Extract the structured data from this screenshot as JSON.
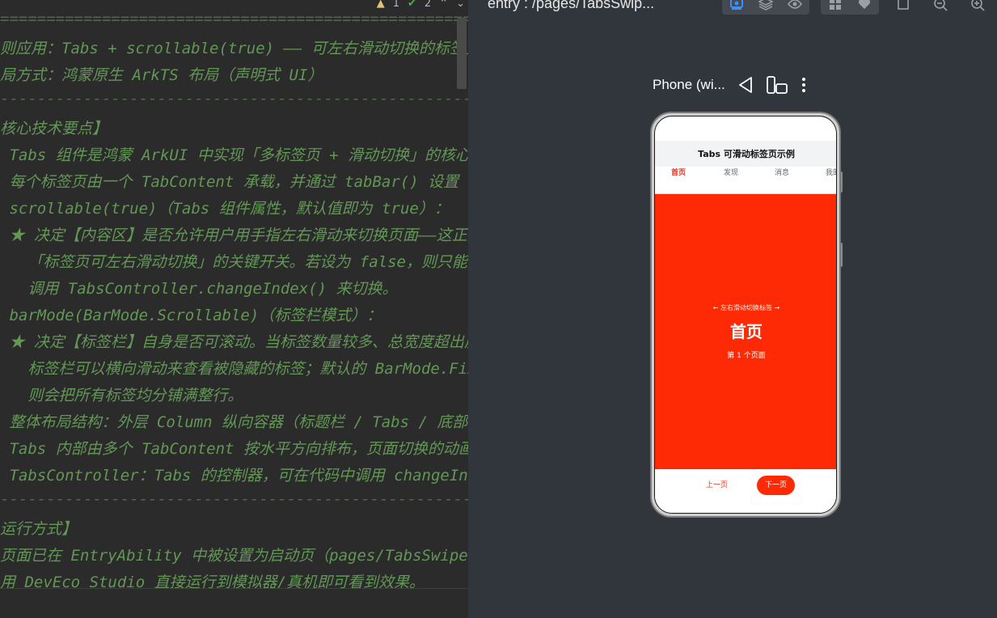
{
  "editor": {
    "status": {
      "warnings": "1",
      "checks": "2"
    },
    "lines": [
      {
        "text": "===============================================================",
        "kind": "rule"
      },
      {
        "text": "则应用：Tabs + scrollable(true) —— 可左右滑动切换的标签页",
        "kind": "comment"
      },
      {
        "text": "局方式：鸿蒙原生 ArkTS 布局（声明式 UI）",
        "kind": "comment"
      },
      {
        "text": "---------------------------------------------------------------",
        "kind": "rule"
      },
      {
        "text": "核心技术要点】",
        "kind": "comment"
      },
      {
        "text": " Tabs 组件是鸿蒙 ArkUI 中实现「多标签页 + 滑动切换」的核心",
        "kind": "comment"
      },
      {
        "text": " 每个标签页由一个 TabContent 承载，并通过 tabBar() 设置",
        "kind": "comment"
      },
      {
        "text": " scrollable(true)（Tabs 组件属性，默认值即为 true）：",
        "kind": "comment"
      },
      {
        "text": " ★ 决定【内容区】是否允许用户用手指左右滑动来切换页面——这正是",
        "kind": "comment"
      },
      {
        "text": "   「标签页可左右滑动切换」的关键开关。若设为 false，则只能",
        "kind": "comment"
      },
      {
        "text": "   调用 TabsController.changeIndex() 来切换。",
        "kind": "comment"
      },
      {
        "text": " barMode(BarMode.Scrollable)（标签栏模式）：",
        "kind": "comment"
      },
      {
        "text": " ★ 决定【标签栏】自身是否可滚动。当标签数量较多、总宽度超出屏",
        "kind": "comment"
      },
      {
        "text": "   标签栏可以横向滑动来查看被隐藏的标签；默认的 BarMode.Fixed",
        "kind": "comment"
      },
      {
        "text": "   则会把所有标签均分铺满整行。",
        "kind": "comment"
      },
      {
        "text": " 整体布局结构：外层 Column 纵向容器（标题栏 / Tabs / 底部",
        "kind": "comment"
      },
      {
        "text": " Tabs 内部由多个 TabContent 按水平方向排布，页面切换的动画",
        "kind": "comment"
      },
      {
        "text": " TabsController：Tabs 的控制器，可在代码中调用 changeIndex",
        "kind": "comment"
      },
      {
        "text": "---------------------------------------------------------------",
        "kind": "rule"
      },
      {
        "text": "运行方式】",
        "kind": "comment"
      },
      {
        "text": "页面已在 EntryAbility 中被设置为启动页（pages/TabsSwipe",
        "kind": "comment"
      },
      {
        "text": "用 DevEco Studio 直接运行到模拟器/真机即可看到效果。",
        "kind": "comment"
      }
    ]
  },
  "previewer": {
    "title": "entry : /pages/TabsSwip...",
    "tool_icons": {
      "inspector": "inspector-icon",
      "layers": "layers-icon",
      "eye": "eye-icon",
      "components": "components-icon",
      "heart": "heart-icon",
      "fit": "fit-icon",
      "zoom_out": "zoom-out-icon",
      "zoom_in": "zoom-in-icon",
      "fullscreen": "fullscreen-icon"
    },
    "device_name": "Phone (wi...",
    "accent": "#3d8ff5"
  },
  "app": {
    "title": "Tabs 可滑动标签页示例",
    "tabs": [
      {
        "label": "首页",
        "active": true
      },
      {
        "label": "发现",
        "active": false
      },
      {
        "label": "消息",
        "active": false
      },
      {
        "label": "我的",
        "active": false
      }
    ],
    "page": {
      "hint": "← 左右滑动切换标签 →",
      "heading": "首页",
      "subtitle": "第 1 个页面",
      "color": "#fe2a05"
    },
    "nav": {
      "prev_label": "上一页",
      "next_label": "下一页"
    },
    "accent": "#e0301e"
  }
}
